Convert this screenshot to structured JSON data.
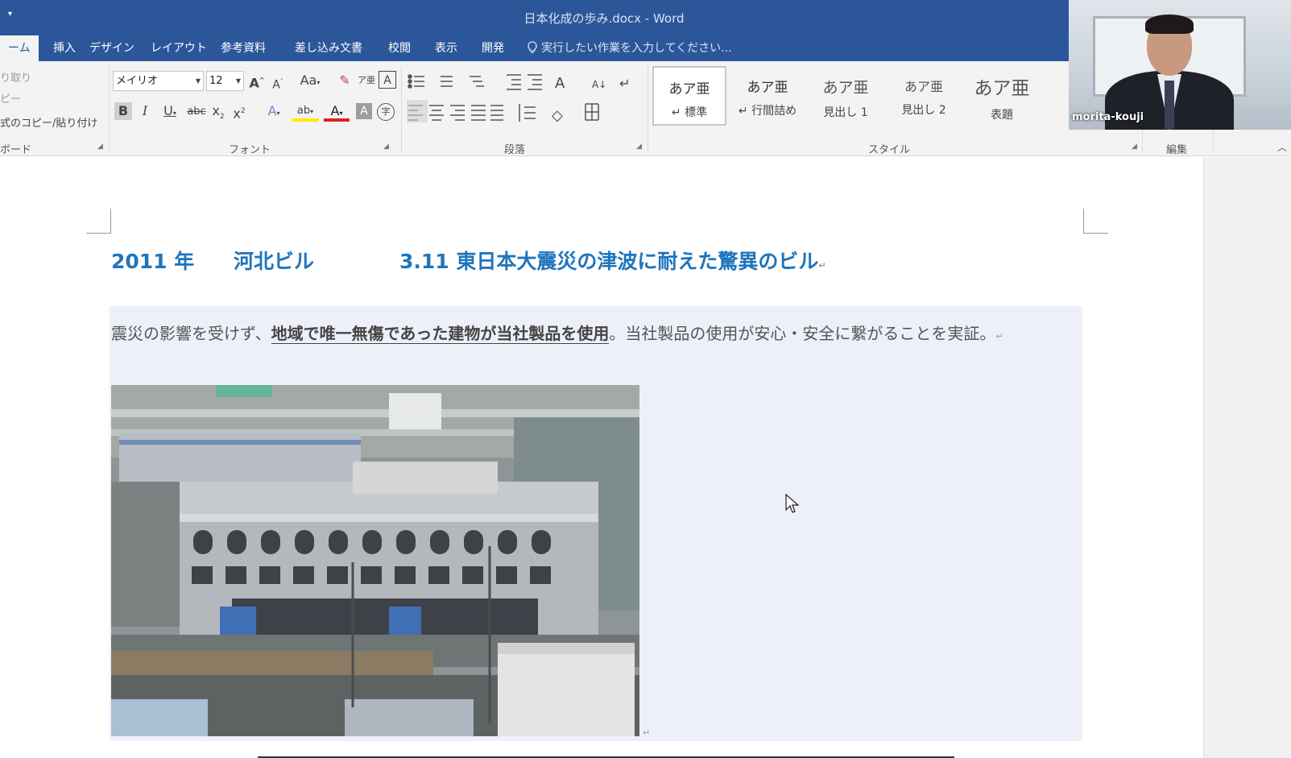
{
  "titlebar": {
    "quick_access": "▾",
    "title": "日本化成の歩み.docx - Word"
  },
  "tabs": [
    {
      "label": "ーム",
      "active": true
    },
    {
      "label": "挿入"
    },
    {
      "label": "デザイン"
    },
    {
      "label": "レイアウト"
    },
    {
      "label": "参考資料"
    },
    {
      "label": "差し込み文書"
    },
    {
      "label": "校閲"
    },
    {
      "label": "表示"
    },
    {
      "label": "開発"
    }
  ],
  "tell_me": "実行したい作業を入力してください...",
  "ribbon": {
    "clipboard": {
      "cut": "り取り",
      "copy": "ピー",
      "format_painter": "式のコピー/貼り付け",
      "label": "ボード"
    },
    "font": {
      "name": "メイリオ",
      "size": "12",
      "label": "フォント",
      "case_button": "Aa"
    },
    "paragraph": {
      "label": "段落"
    },
    "styles": {
      "label": "スタイル",
      "items": [
        {
          "sample": "あア亜",
          "name": "↵ 標準"
        },
        {
          "sample": "あア亜",
          "name": "↵ 行間詰め"
        },
        {
          "sample": "あア亜",
          "name": "見出し 1"
        },
        {
          "sample": "あア亜",
          "name": "見出し 2"
        },
        {
          "sample": "あア亜",
          "name": "表題"
        }
      ]
    },
    "editing": {
      "label": "編集"
    }
  },
  "video": {
    "participant": "morita-kouji"
  },
  "document": {
    "heading": {
      "year": "2011 年",
      "building": "河北ビル",
      "event": "3.11 東日本大震災の津波に耐えた驚異のビル"
    },
    "paragraph": {
      "before": "震災の影響を受けず、",
      "emphasis": "地域で唯一無傷であった建物が当社製品を使用",
      "after": "。当社製品の使用が安心・安全に繋がることを実証。"
    },
    "paragraph_mark": "↵"
  }
}
